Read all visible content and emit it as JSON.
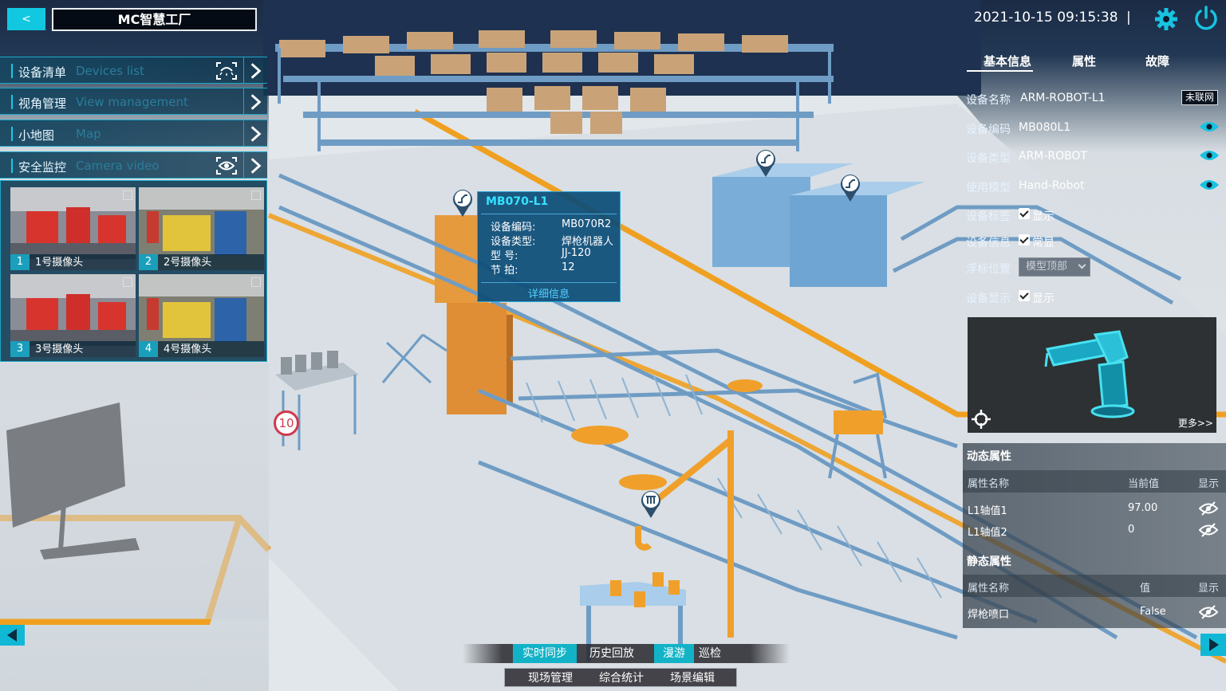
{
  "header": {
    "back_label": "<",
    "app_title": "MC智慧工厂"
  },
  "left_menu": {
    "items": [
      {
        "cn": "设备清单",
        "en": "Devices list"
      },
      {
        "cn": "视角管理",
        "en": "View management"
      },
      {
        "cn": "小地图",
        "en": "Map"
      },
      {
        "cn": "安全监控",
        "en": "Camera video"
      }
    ],
    "cameras": [
      {
        "num": "1",
        "label": "1号摄像头"
      },
      {
        "num": "2",
        "label": "2号摄像头"
      },
      {
        "num": "3",
        "label": "3号摄像头"
      },
      {
        "num": "4",
        "label": "4号摄像头"
      }
    ]
  },
  "topbar": {
    "datetime": "2021-10-15 09:15:38",
    "separator": "|"
  },
  "right_panel": {
    "tabs": [
      "基本信息",
      "属性",
      "故障"
    ],
    "info": {
      "name_label": "设备名称",
      "name_value": "ARM-ROBOT-L1",
      "status": "未联网",
      "code_label": "设备编码",
      "code_value": "MB080L1",
      "type_label": "设备类型",
      "type_value": "ARM-ROBOT",
      "model_label": "使用模型",
      "model_value": "Hand-Robot",
      "tag_label": "设备标签",
      "tag_value": "显示",
      "infoshow_label": "设备信息",
      "infoshow_value": "常显",
      "float_label": "浮标位置",
      "float_value": "模型顶部",
      "display_label": "设备显示",
      "display_value": "显示"
    },
    "preview": {
      "more": "更多>>"
    },
    "dynamic": {
      "title": "动态属性",
      "headers": [
        "属性名称",
        "当前值",
        "显示"
      ],
      "rows": [
        {
          "name": "L1轴值1",
          "value": "97.00"
        },
        {
          "name": "L1轴值2",
          "value": "0"
        }
      ]
    },
    "static": {
      "title": "静态属性",
      "headers": [
        "属性名称",
        "值",
        "显示"
      ],
      "rows": [
        {
          "name": "焊枪喷口",
          "value": "False"
        }
      ]
    }
  },
  "popup": {
    "title": "MB070-L1",
    "rows": [
      {
        "k": "设备编码:",
        "v": "MB070R2"
      },
      {
        "k": "设备类型:",
        "v": "焊枪机器人"
      },
      {
        "k": "型      号:",
        "v": "JJ-120"
      },
      {
        "k": "节      拍:",
        "v": "12"
      }
    ],
    "detail": "详细信息"
  },
  "scene": {
    "badge": "10"
  },
  "bottom": {
    "modes": [
      "实时同步",
      "历史回放",
      "漫游",
      "巡检"
    ],
    "functions": [
      "现场管理",
      "综合统计",
      "场景编辑"
    ]
  },
  "colors": {
    "accent": "#12c7e0",
    "orange": "#f39c12",
    "steel_blue": "#6f9cc4"
  }
}
